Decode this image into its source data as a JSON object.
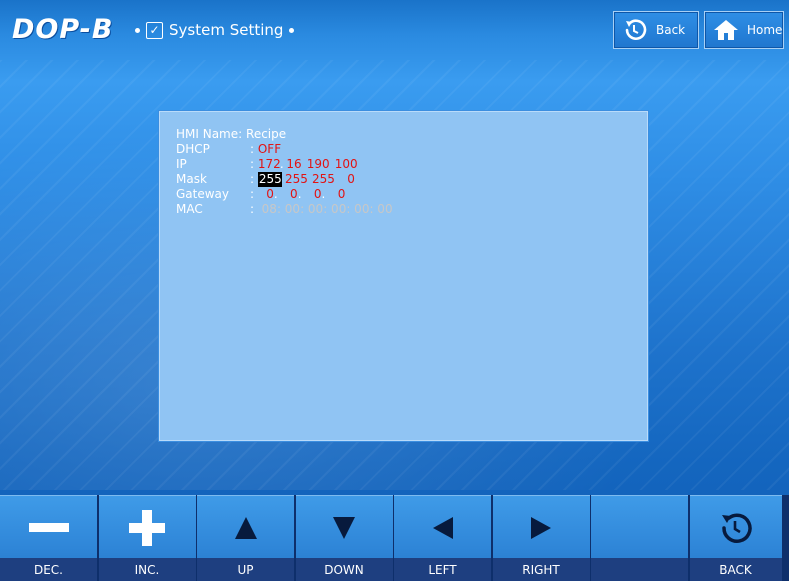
{
  "header": {
    "logo": "DOP-B",
    "crumb": "System Setting",
    "back_label": "Back",
    "home_label": "Home"
  },
  "info": {
    "hmi_name_label": "HMI Name:",
    "hmi_name_value": "Recipe",
    "dhcp_label": "DHCP",
    "dhcp_value": "OFF",
    "ip_label": "IP",
    "ip_octets": [
      "172",
      "16",
      "190",
      "100"
    ],
    "mask_label": "Mask",
    "mask_octets": [
      "255",
      "255",
      "255",
      "0"
    ],
    "gateway_label": "Gateway",
    "gateway_octets": [
      "0",
      "0",
      "0",
      "0"
    ],
    "mac_label": "MAC",
    "mac_value": "08: 00: 00: 00: 00: 00"
  },
  "keys": [
    {
      "label": "DEC.",
      "icon": "minus-icon"
    },
    {
      "label": "INC.",
      "icon": "plus-icon"
    },
    {
      "label": "UP",
      "icon": "arrow-up-icon"
    },
    {
      "label": "DOWN",
      "icon": "arrow-down-icon"
    },
    {
      "label": "LEFT",
      "icon": "arrow-left-icon"
    },
    {
      "label": "RIGHT",
      "icon": "arrow-right-icon"
    },
    {
      "label": "",
      "icon": ""
    },
    {
      "label": "BACK",
      "icon": "back-icon"
    }
  ],
  "colors": {
    "value_red": "#e21313",
    "panel": "#90c4f3",
    "accent": "#2f86d8"
  }
}
